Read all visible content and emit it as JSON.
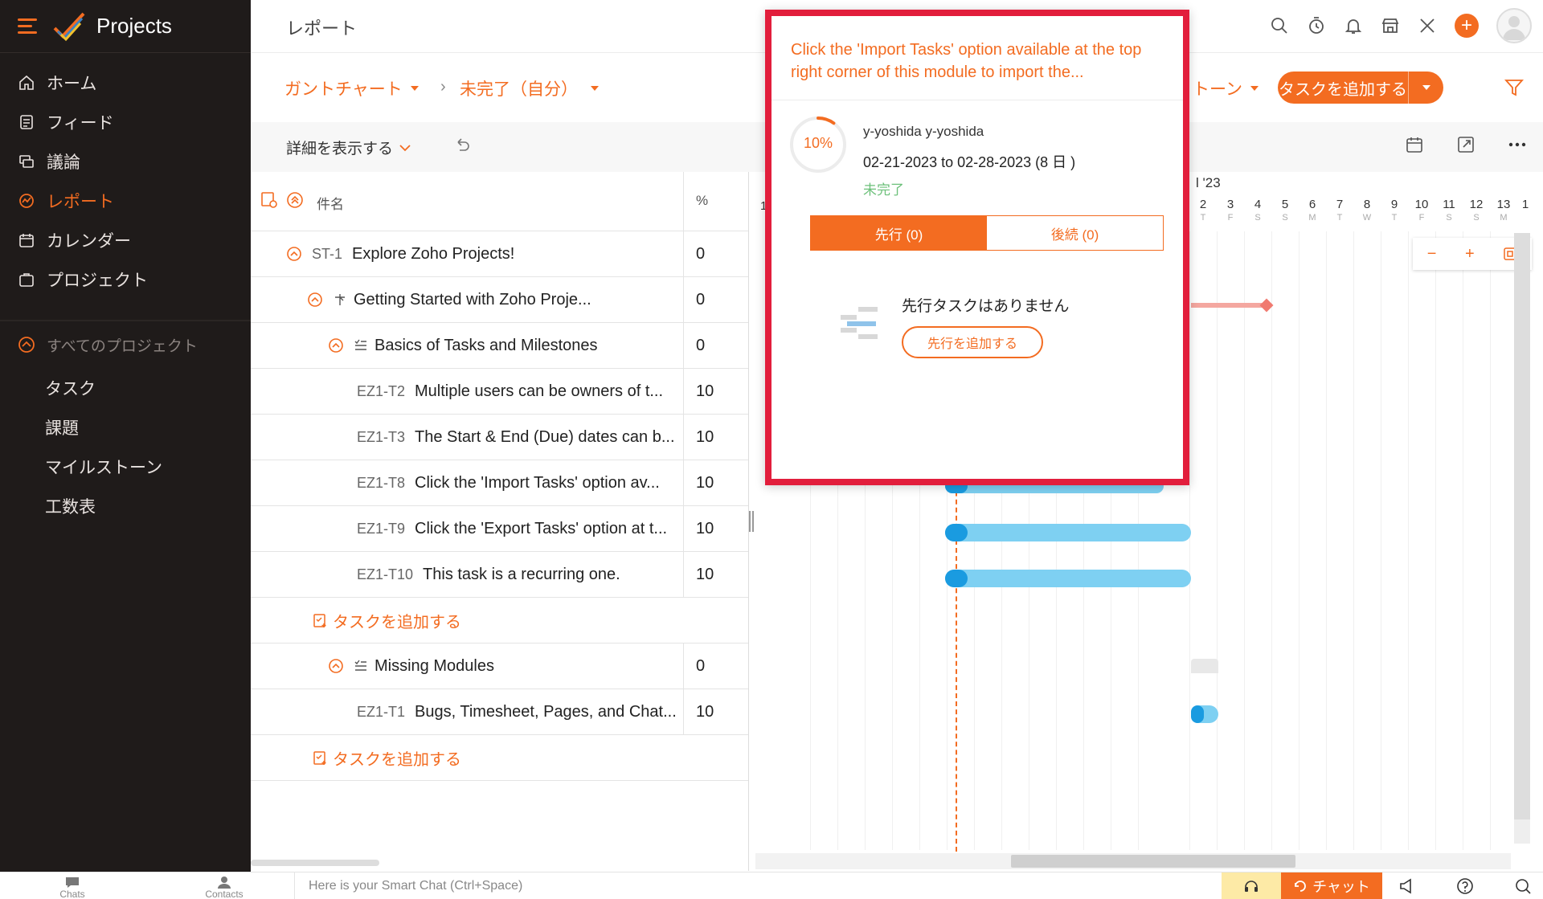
{
  "app": {
    "name": "Projects"
  },
  "sidebar": {
    "items": [
      {
        "label": "ホーム",
        "icon": "home-icon"
      },
      {
        "label": "フィード",
        "icon": "feed-icon"
      },
      {
        "label": "議論",
        "icon": "discussion-icon"
      },
      {
        "label": "レポート",
        "icon": "report-icon",
        "active": true
      },
      {
        "label": "カレンダー",
        "icon": "calendar-icon"
      },
      {
        "label": "プロジェクト",
        "icon": "project-icon"
      }
    ],
    "all_projects": "すべてのプロジェクト",
    "sub_items": [
      "タスク",
      "課題",
      "マイルストーン",
      "工数表"
    ]
  },
  "header": {
    "title": "レポート"
  },
  "subheader": {
    "view": "ガントチャート",
    "filter": "未完了（自分）",
    "milestone_cut": "トーン",
    "add_task": "タスクを追加する"
  },
  "toolbar": {
    "show_detail": "詳細を表示する"
  },
  "table": {
    "col_name": "件名",
    "col_pct": "%",
    "rows": [
      {
        "id": "ST-1",
        "name": "Explore Zoho Projects!",
        "pct": "0"
      },
      {
        "id": "",
        "name": "Getting Started with Zoho Proje...",
        "pct": "0"
      },
      {
        "id": "",
        "name": "Basics of Tasks and Milestones",
        "pct": "0"
      },
      {
        "id": "EZ1-T2",
        "name": "Multiple users can be owners of t...",
        "pct": "10"
      },
      {
        "id": "EZ1-T3",
        "name": "The Start & End (Due) dates can b...",
        "pct": "10"
      },
      {
        "id": "EZ1-T8",
        "name": "Click the 'Import Tasks' option av...",
        "pct": "10"
      },
      {
        "id": "EZ1-T9",
        "name": "Click the 'Export Tasks' option at t...",
        "pct": "10"
      },
      {
        "id": "EZ1-T10",
        "name": "This task is a recurring one.",
        "pct": "10"
      },
      {
        "id": "",
        "name": "タスクを追加する",
        "pct": ""
      },
      {
        "id": "",
        "name": "Missing Modules",
        "pct": "0"
      },
      {
        "id": "EZ1-T1",
        "name": "Bugs, Timesheet, Pages, and Chat...",
        "pct": "10"
      },
      {
        "id": "",
        "name": "タスクを追加する",
        "pct": ""
      }
    ]
  },
  "gantt": {
    "month": "l '23",
    "days": [
      {
        "d": "2",
        "w": "T"
      },
      {
        "d": "3",
        "w": "F"
      },
      {
        "d": "4",
        "w": "S"
      },
      {
        "d": "5",
        "w": "S"
      },
      {
        "d": "6",
        "w": "M"
      },
      {
        "d": "7",
        "w": "T"
      },
      {
        "d": "8",
        "w": "W"
      },
      {
        "d": "9",
        "w": "T"
      },
      {
        "d": "10",
        "w": "F"
      },
      {
        "d": "11",
        "w": "S"
      },
      {
        "d": "12",
        "w": "S"
      },
      {
        "d": "13",
        "w": "M"
      },
      {
        "d": "1",
        "w": ""
      }
    ],
    "left_day": "1"
  },
  "popup": {
    "title": "Click the 'Import Tasks' option available at the top right corner of this module to import the...",
    "progress": "10%",
    "progress_value": 10,
    "owner": "y-yoshida y-yoshida",
    "dates": "02-21-2023 to 02-28-2023 (8 日 )",
    "status": "未完了",
    "tab_pred": "先行 (0)",
    "tab_succ": "後続 (0)",
    "empty_text": "先行タスクはありません",
    "add_pred": "先行を追加する"
  },
  "bottombar": {
    "chats": "Chats",
    "contacts": "Contacts",
    "smart_chat": "Here is your Smart Chat (Ctrl+Space)",
    "chat_button": "チャット"
  },
  "colors": {
    "accent": "#f36c21",
    "sidebar_bg": "#1f1b1a",
    "bar": "#7ed0f2",
    "highlight": "#e21e3c"
  }
}
